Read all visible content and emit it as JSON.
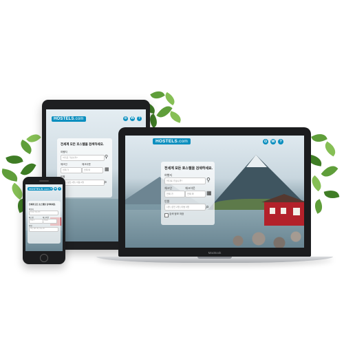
{
  "brand": {
    "name": "HOSTELS",
    "suffix": ".com",
    "color": "#0b8fbf"
  },
  "nav": {
    "icons": [
      "currency-icon",
      "globe-icon",
      "help-icon"
    ],
    "glyphs": [
      "⊙",
      "W",
      "?"
    ]
  },
  "search": {
    "headline": "전세계 모든 호스텔을 검색하세요.",
    "destination_label": "여행지",
    "destination_placeholder": "어디로 가십니까?",
    "checkin_label": "체크인",
    "checkout_label": "체크아웃",
    "checkin_value": "언제 가",
    "checkout_value": "언제 와",
    "guests_label": "인원",
    "guests_value": "1명 | 성인 2명 | 아동 0명",
    "remember_label": "검색 정보 저장"
  },
  "laptop": {
    "model_label": "MacBook"
  },
  "colors": {
    "accent": "#0b8fbf",
    "cabin": "#b3212a"
  }
}
